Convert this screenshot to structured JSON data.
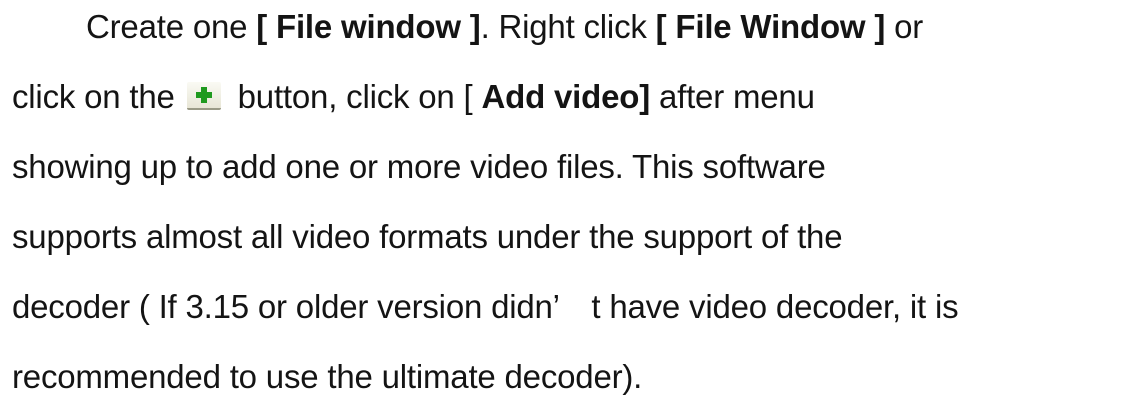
{
  "paragraph": {
    "l1_a": "Create one ",
    "l1_b": "[ File window ]",
    "l1_c": ". Right click ",
    "l1_d": "[ File Window ]",
    "l1_e": " or",
    "l2_a": "click on the",
    "l2_b": " button, click on [ ",
    "l2_c": "Add video]",
    "l2_d": " after menu",
    "l3": "showing up to add one or more video files. This software",
    "l4": "supports almost all video formats under the support of the",
    "l5": "decoder ( If 3.15 or older version didn’　t have video decoder, it is",
    "l6": "recommended to use the ultimate decoder)."
  },
  "icons": {
    "add_button": "plus-icon",
    "plus_color": "#1f9a1f"
  }
}
